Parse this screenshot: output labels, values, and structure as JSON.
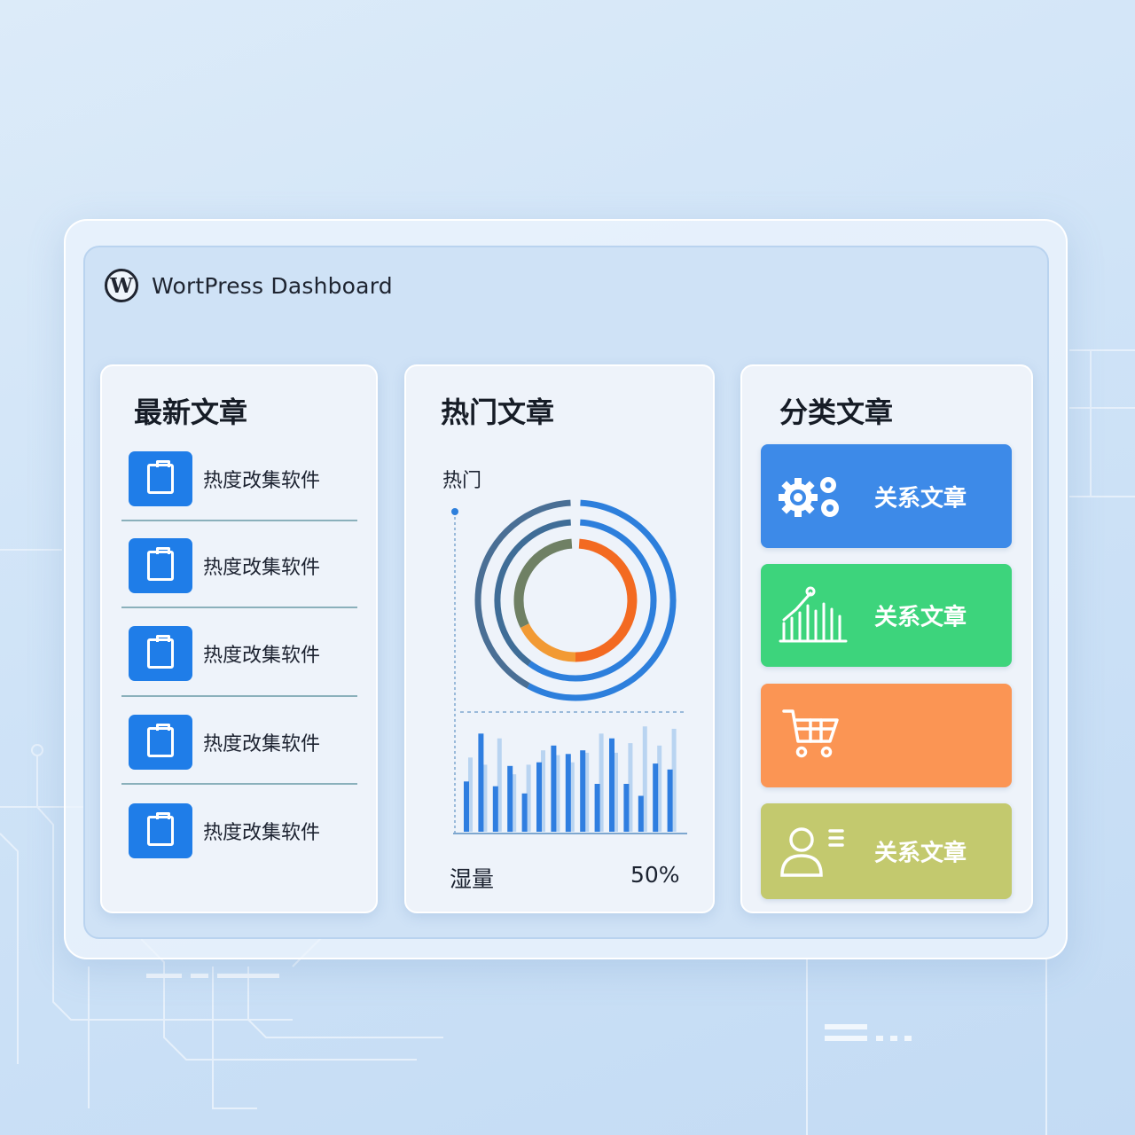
{
  "app": {
    "logo_letter": "W",
    "title": "WortPress Dashboard"
  },
  "latest_posts": {
    "title": "最新文章",
    "items": [
      {
        "label": "热度改集软件"
      },
      {
        "label": "热度改集软件"
      },
      {
        "label": "热度改集软件"
      },
      {
        "label": "热度改集软件"
      },
      {
        "label": "热度改集软件"
      }
    ]
  },
  "popular_posts": {
    "title": "热门文章",
    "subtitle": "热门",
    "footer_left": "湿量",
    "footer_right": "50%"
  },
  "categories": {
    "title": "分类文章",
    "tiles": [
      {
        "icon": "gears-icon",
        "label": "关系文章",
        "color": "#3d8ae8"
      },
      {
        "icon": "bar-chart-icon",
        "label": "关系文章",
        "color": "#3dd47c"
      },
      {
        "icon": "cart-icon",
        "label": "",
        "color": "#fb9554"
      },
      {
        "icon": "user-list-icon",
        "label": "关系文章",
        "color": "#c3c96e"
      }
    ]
  },
  "chart_data": [
    {
      "type": "pie",
      "title": "",
      "rings": [
        {
          "name": "outer",
          "value": 1.0,
          "colors": [
            "#2d7fdc",
            "#4a6f95"
          ]
        },
        {
          "name": "middle",
          "value": 1.0,
          "colors": [
            "#2d7fdc",
            "#3f6d97"
          ]
        },
        {
          "name": "inner",
          "segments": [
            {
              "value": 0.5,
              "color": "#f36a21"
            },
            {
              "value": 0.18,
              "color": "#f29a34"
            },
            {
              "value": 0.32,
              "color": "#6f8064"
            }
          ]
        }
      ]
    },
    {
      "type": "bar",
      "title": "",
      "xlabel": "",
      "ylabel": "",
      "ylim": [
        0,
        100
      ],
      "series": [
        {
          "values": [
            42,
            82,
            38,
            55,
            32,
            58,
            72,
            65,
            68,
            40,
            78,
            40,
            30,
            57,
            52
          ]
        },
        {
          "values": [
            62,
            56,
            78,
            48,
            56,
            68,
            64,
            58,
            66,
            82,
            66,
            74,
            88,
            72,
            86
          ]
        }
      ]
    }
  ]
}
